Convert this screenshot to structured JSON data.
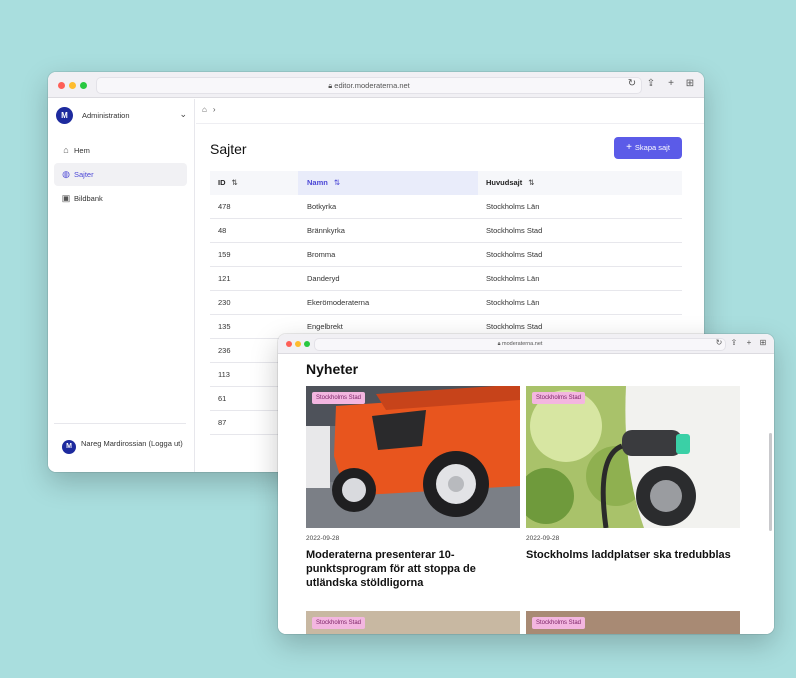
{
  "editor_window": {
    "url": "editor.moderaterna.net",
    "sidebar": {
      "logo_text": "M",
      "brand_label": "Administration",
      "items": [
        {
          "label": "Hem",
          "icon": "home-icon"
        },
        {
          "label": "Sajter",
          "icon": "globe-icon",
          "active": true
        },
        {
          "label": "Bildbank",
          "icon": "images-icon"
        }
      ],
      "user_name": "Nareg Mardirossian (Logga ut)"
    },
    "page_title": "Sajter",
    "create_button": "Skapa sajt",
    "table": {
      "columns": [
        "ID",
        "Namn",
        "Huvudsajt"
      ],
      "sort_glyph": "⇅",
      "rows": [
        [
          "478",
          "Botkyrka",
          "Stockholms Län"
        ],
        [
          "48",
          "Brännkyrka",
          "Stockholms Stad"
        ],
        [
          "159",
          "Bromma",
          "Stockholms Stad"
        ],
        [
          "121",
          "Danderyd",
          "Stockholms Län"
        ],
        [
          "230",
          "Ekerömoderaterna",
          "Stockholms Län"
        ],
        [
          "135",
          "Engelbrekt",
          "Stockholms Stad"
        ],
        [
          "236",
          "",
          ""
        ],
        [
          "113",
          "",
          ""
        ],
        [
          "61",
          "",
          ""
        ],
        [
          "87",
          "",
          ""
        ]
      ]
    }
  },
  "site_window": {
    "url": "moderaterna.net",
    "section_title": "Nyheter",
    "cards": [
      {
        "badge": "Stockholms Stad",
        "date": "2022-09-28",
        "headline": "Moderaterna presenterar 10-punktsprogram för att stoppa de utländska stöldligorna"
      },
      {
        "badge": "Stockholms Stad",
        "date": "2022-09-28",
        "headline": "Stockholms laddplatser ska tredubblas"
      },
      {
        "badge": "Stockholms Stad",
        "date": "",
        "headline": ""
      },
      {
        "badge": "Stockholms Stad",
        "date": "",
        "headline": ""
      }
    ]
  },
  "colors": {
    "background": "#a9dede",
    "accent": "#5b5be8",
    "brand": "#1d2a9e",
    "badge": "#f3b6e0"
  }
}
